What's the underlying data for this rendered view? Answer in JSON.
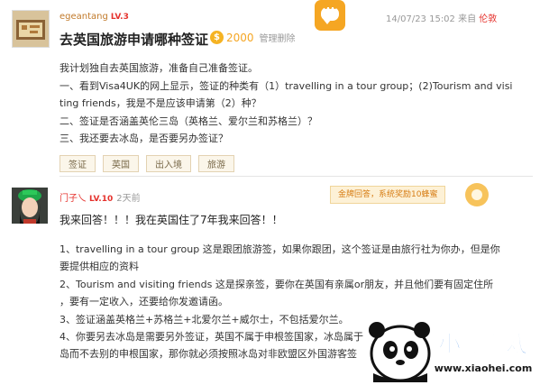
{
  "question": {
    "username": "egeantang",
    "level": "LV.3",
    "timestamp": "14/07/23 15:02",
    "source_label": "来自",
    "source_link": "伦敦",
    "title": "去英国旅游申请哪种签证",
    "bounty": "2000",
    "admin_action": "管理删除",
    "body_lines": [
      "我计划独自去英国旅游，准备自己准备签证。",
      "一、看到Visa4UK的网上显示，签证的种类有（1）travelling in a tour group；(2)Tourism and visi",
      "ting friends，我是不是应该申请第（2）种？",
      "二、签证是否涵盖英伦三岛（英格兰、爱尔兰和苏格兰）？",
      "三、我还要去冰岛，是否要另办签证？"
    ],
    "tags": [
      "签证",
      "英国",
      "出入境",
      "旅游"
    ]
  },
  "answer": {
    "username": "门子乀",
    "level": "LV.10",
    "time": "2天前",
    "reward": "金牌回答，系统奖励10蜂蜜",
    "lead": "我来回答！！！我在英国住了7年我来回答！！",
    "body_lines": [
      "1、travelling in a tour group 这是跟团旅游签，如果你跟团，这个签证是由旅行社为你办，但是你",
      "要提供相应的资料",
      "2、Tourism and visiting friends 这是探亲签，要你在英国有亲属or朋友，并且他们要有固定住所",
      "，要有一定收入，还要给你发邀请函。",
      "3、签证涵盖英格兰+苏格兰+北爱尔兰+威尔士，不包括爱尔兰。",
      "4、你要另去冰岛是需要另外签证，英国不属于申根签国家，冰岛属于",
      "岛而不去别的申根国家，那你就必须按照冰岛对非欧盟区外国游客签"
    ]
  },
  "watermark": {
    "brand": "小黑游戏",
    "url": "www.xiaohei.com"
  },
  "colors": {
    "accent_orange": "#f5a623",
    "link_red": "#e5322d",
    "username_brown": "#c17a2b"
  }
}
